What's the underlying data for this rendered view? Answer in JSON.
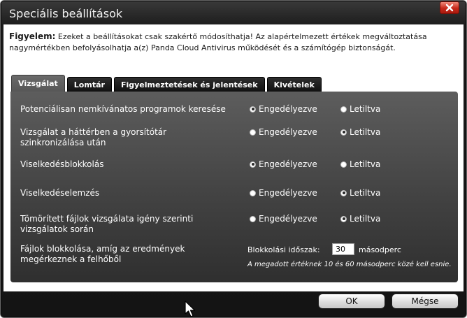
{
  "window": {
    "title": "Speciális beállítások"
  },
  "warning": {
    "strong": "Figyelem:",
    "text": " Ezeket a beállításokat csak szakértő módosíthatja! Az alapértelmezett értékek megváltoztatása nagymértékben befolyásolhatja a(z) Panda Cloud Antivirus működését és a számítógép biztonságát."
  },
  "tabs": [
    {
      "label": "Vizsgálat",
      "active": true
    },
    {
      "label": "Lomtár",
      "active": false
    },
    {
      "label": "Figyelmeztetések és jelentések",
      "active": false
    },
    {
      "label": "Kivételek",
      "active": false
    }
  ],
  "options": {
    "enabled_label": "Engedélyezve",
    "disabled_label": "Letiltva"
  },
  "settings": [
    {
      "label": "Potenciálisan nemkívánatos programok keresése",
      "value": "enabled"
    },
    {
      "label": "Vizsgálat a háttérben a gyorsítótár szinkronizálása után",
      "value": "disabled"
    },
    {
      "label": "Viselkedésblokkolás",
      "value": "enabled"
    },
    {
      "label": "Viselkedéselemzés",
      "value": "disabled"
    },
    {
      "label": "Tömörített fájlok vizsgálata igény szerinti vizsgálatok során",
      "value": "disabled"
    }
  ],
  "blocking": {
    "label": "Fájlok blokkolása, amíg az eredmények megérkeznek a felhőből",
    "time_label": "Blokkolási időszak:",
    "time_value": "30",
    "unit": "másodperc",
    "hint": "A megadott értéknek 10 és 60 másodperc közé kell esnie."
  },
  "buttons": {
    "ok": "OK",
    "cancel": "Mégse"
  },
  "colors": {
    "close_button": "#c7281a",
    "panel": "#4a4a4a"
  }
}
